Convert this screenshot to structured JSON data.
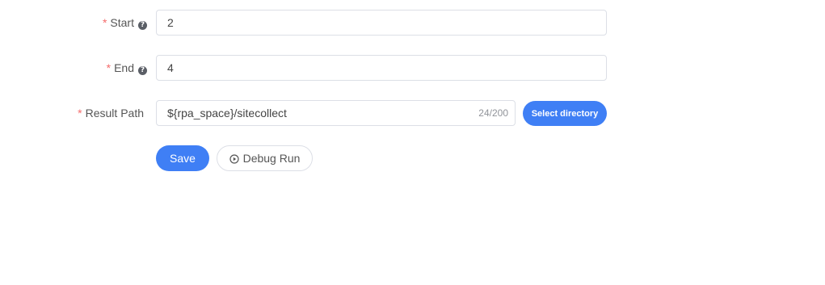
{
  "form": {
    "start": {
      "required_mark": "*",
      "label": "Start",
      "help_icon": "question-circle-icon",
      "value": "2"
    },
    "end": {
      "required_mark": "*",
      "label": "End",
      "help_icon": "question-circle-icon",
      "value": "4"
    },
    "result_path": {
      "required_mark": "*",
      "label": "Result Path",
      "value": "${rpa_space}/sitecollect",
      "counter": "24/200",
      "select_button_label": "Select directory"
    }
  },
  "actions": {
    "save_label": "Save",
    "debug_label": "Debug Run",
    "debug_icon": "play-circle-icon"
  },
  "colors": {
    "primary": "#3f7ff5",
    "required": "#f56c6c",
    "border": "#dcdfe6"
  }
}
